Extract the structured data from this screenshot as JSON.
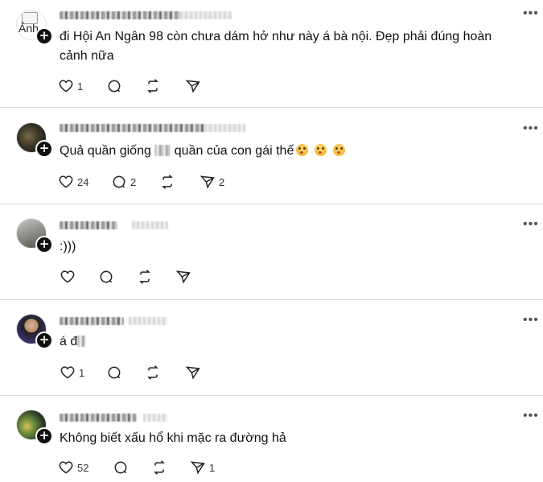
{
  "icons": {
    "like": "heart-icon",
    "reply": "comment-bubble-icon",
    "repost": "repost-icon",
    "share": "send-icon",
    "more": "more-dots-icon",
    "follow": "plus-icon"
  },
  "avatar_alt": "Ảnh",
  "comments": [
    {
      "text": "đi Hội An Ngân 98 còn chưa dám hở như này á bà nội. Đẹp phải đúng hoàn cảnh nữa",
      "likes": "1",
      "replies": "",
      "reposts": "",
      "shares": ""
    },
    {
      "text_before": "Quả quần giống ",
      "text_after": " quần của con gái thế",
      "emoji_count": 3,
      "likes": "24",
      "replies": "2",
      "reposts": "",
      "shares": "2"
    },
    {
      "text": ":)))",
      "likes": "",
      "replies": "",
      "reposts": "",
      "shares": ""
    },
    {
      "text": "á đ",
      "likes": "1",
      "replies": "",
      "reposts": "",
      "shares": ""
    },
    {
      "text": "Không biết xấu hổ khi mặc ra đường hả",
      "likes": "52",
      "replies": "",
      "reposts": "",
      "shares": "1"
    }
  ]
}
